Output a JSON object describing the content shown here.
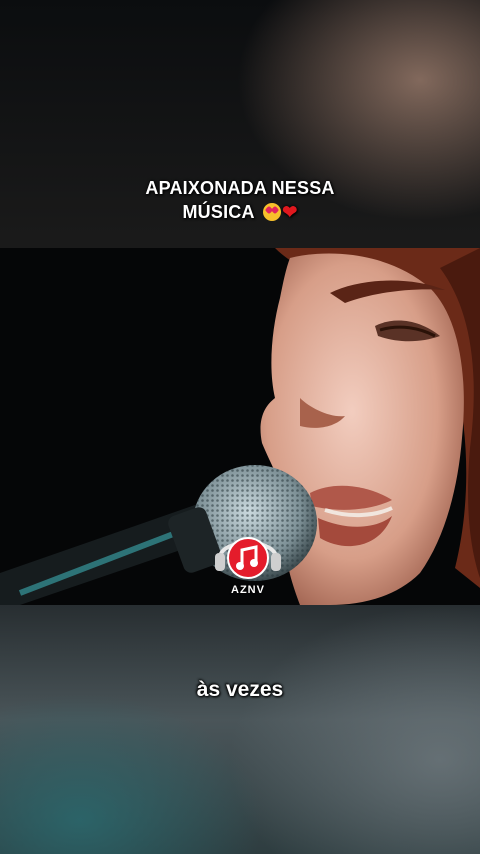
{
  "caption": {
    "line1": "APAIXONADA NESSA",
    "line2": "MÚSICA"
  },
  "icons": {
    "emoji_1": "heart-eyes-emoji-icon",
    "emoji_2": "red-heart-icon",
    "logo": "music-note-headphones-logo-icon"
  },
  "logo": {
    "text": "AZNV",
    "color": "#e41c2b"
  },
  "video": {
    "subtitle": "às vezes"
  }
}
